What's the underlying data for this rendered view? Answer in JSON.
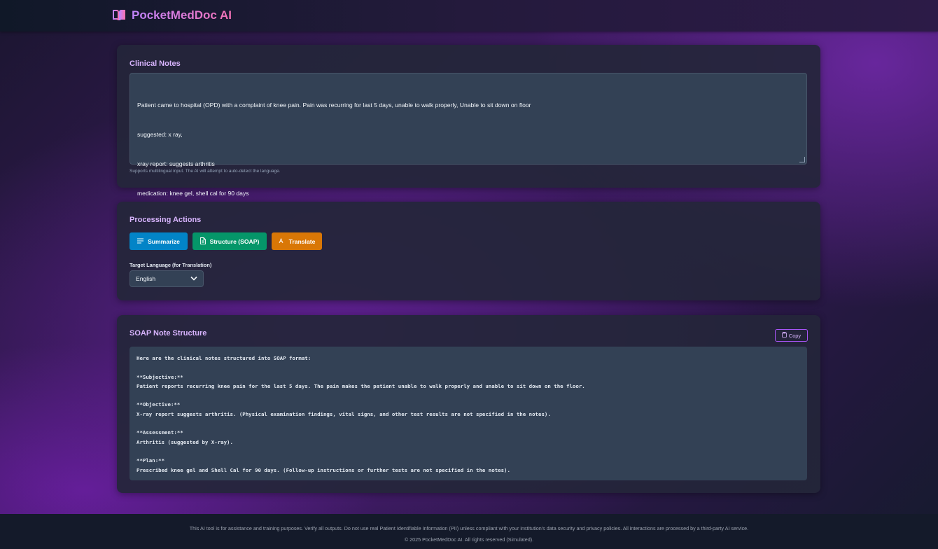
{
  "header": {
    "title": "PocketMedDoc AI",
    "logo_icon": "book-open-icon"
  },
  "clinical_notes": {
    "title": "Clinical Notes",
    "value_lines": [
      "Patient came to hospital (OPD) with a complaint of knee pain. Pain was recurring for last 5 days, unable to walk properly, Unable to sit down on floor",
      "suggested: x ray,",
      "xray report: suggests arthritis",
      "medication: knee gel, shell cal for 90 days"
    ],
    "hint": "Supports multilingual input. The AI will attempt to auto-detect the language."
  },
  "processing": {
    "title": "Processing Actions",
    "buttons": [
      {
        "label": "Summarize",
        "icon": "list-icon",
        "color": "#0284c7"
      },
      {
        "label": "Structure (SOAP)",
        "icon": "document-icon",
        "color": "#059669"
      },
      {
        "label": "Translate",
        "icon": "translate-icon",
        "color": "#d97706"
      }
    ],
    "language_label": "Target Language (for Translation)",
    "language_selected": "English"
  },
  "soap": {
    "title": "SOAP Note Structure",
    "copy_label": "Copy",
    "lines": [
      "Here are the clinical notes structured into SOAP format:",
      "",
      "**Subjective:**",
      "Patient reports recurring knee pain for the last 5 days. The pain makes the patient unable to walk properly and unable to sit down on the floor.",
      "",
      "**Objective:**",
      "X-ray report suggests arthritis. (Physical examination findings, vital signs, and other test results are not specified in the notes).",
      "",
      "**Assessment:**",
      "Arthritis (suggested by X-ray).",
      "",
      "**Plan:**",
      "Prescribed knee gel and Shell Cal for 90 days. (Follow-up instructions or further tests are not specified in the notes)."
    ]
  },
  "footer": {
    "disclaimer": "This AI tool is for assistance and training purposes. Verify all outputs. Do not use real Patient Identifiable Information (PII) unless compliant with your institution's data security and privacy policies. All interactions are processed by a third-party AI service.",
    "copyright": "© 2025 PocketMedDoc AI. All rights reserved (Simulated)."
  },
  "colors": {
    "accent_purple": "#c084fc",
    "accent_pink": "#f472b6",
    "summarize": "#0284c7",
    "structure": "#059669",
    "translate": "#d97706"
  }
}
